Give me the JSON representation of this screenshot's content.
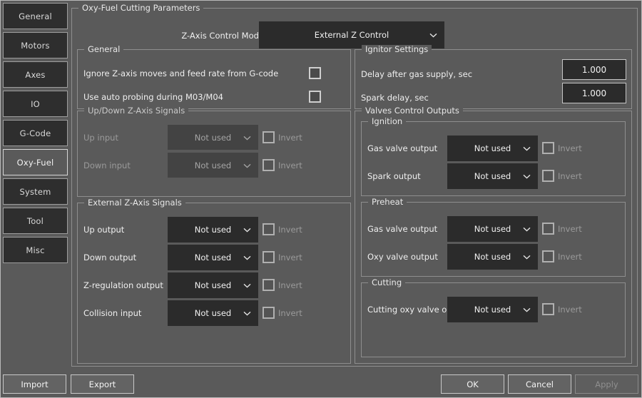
{
  "sidebar": {
    "items": [
      {
        "label": "General",
        "active": false
      },
      {
        "label": "Motors",
        "active": false
      },
      {
        "label": "Axes",
        "active": false
      },
      {
        "label": "IO",
        "active": false
      },
      {
        "label": "G-Code",
        "active": false
      },
      {
        "label": "Oxy-Fuel",
        "active": true
      },
      {
        "label": "System",
        "active": false
      },
      {
        "label": "Tool",
        "active": false
      },
      {
        "label": "Misc",
        "active": false
      }
    ]
  },
  "main": {
    "group_title": "Oxy-Fuel Cutting Parameters",
    "zmode": {
      "label": "Z-Axis Control Mode",
      "value": "External Z Control",
      "icon": "chevron-down-icon"
    },
    "general": {
      "title": "General",
      "rows": [
        {
          "label": "Ignore Z-axis moves and feed rate from G-code",
          "checked": false
        },
        {
          "label": "Use auto probing during M03/M04",
          "checked": false
        }
      ]
    },
    "ignitor": {
      "title": "Ignitor Settings",
      "rows": [
        {
          "label": "Delay after gas supply, sec",
          "value": "1.000"
        },
        {
          "label": "Spark delay, sec",
          "value": "1.000"
        }
      ]
    },
    "updown": {
      "title": "Up/Down Z-Axis Signals",
      "disabled": true,
      "rows": [
        {
          "label": "Up input",
          "value": "Not used",
          "invert_label": "Invert",
          "checked": false
        },
        {
          "label": "Down input",
          "value": "Not used",
          "invert_label": "Invert",
          "checked": false
        }
      ]
    },
    "external": {
      "title": "External Z-Axis Signals",
      "disabled": false,
      "rows": [
        {
          "label": "Up output",
          "value": "Not used",
          "invert_label": "Invert",
          "checked": false
        },
        {
          "label": "Down output",
          "value": "Not used",
          "invert_label": "Invert",
          "checked": false
        },
        {
          "label": "Z-regulation output",
          "value": "Not used",
          "invert_label": "Invert",
          "checked": false
        },
        {
          "label": "Collision input",
          "value": "Not used",
          "invert_label": "Invert",
          "checked": false
        }
      ]
    },
    "valves": {
      "title": "Valves Control Outputs",
      "ignition": {
        "title": "Ignition",
        "rows": [
          {
            "label": "Gas valve output",
            "value": "Not used",
            "invert_label": "Invert",
            "checked": false
          },
          {
            "label": "Spark output",
            "value": "Not used",
            "invert_label": "Invert",
            "checked": false
          }
        ]
      },
      "preheat": {
        "title": "Preheat",
        "rows": [
          {
            "label": "Gas valve output",
            "value": "Not used",
            "invert_label": "Invert",
            "checked": false
          },
          {
            "label": "Oxy valve output",
            "value": "Not used",
            "invert_label": "Invert",
            "checked": false
          }
        ]
      },
      "cutting": {
        "title": "Cutting",
        "rows": [
          {
            "label": "Cutting oxy valve output",
            "value": "Not used",
            "invert_label": "Invert",
            "checked": false
          }
        ]
      }
    }
  },
  "footer": {
    "import_label": "Import",
    "export_label": "Export",
    "ok_label": "OK",
    "cancel_label": "Cancel",
    "apply_label": "Apply"
  },
  "colors": {
    "background": "#5a5a5a",
    "control_dark": "#2b2b2b",
    "border": "#c8c8c8",
    "text": "#efefef",
    "text_disabled": "#9a9a9a"
  }
}
